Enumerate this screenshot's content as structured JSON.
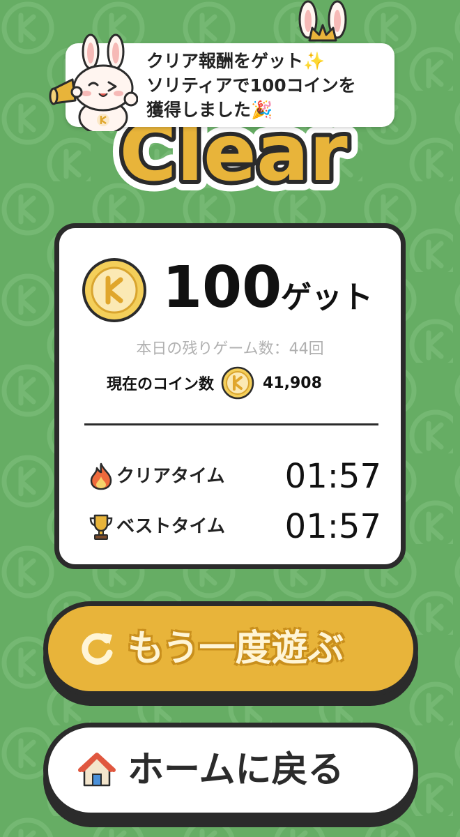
{
  "toast": {
    "line1": "クリア報酬をゲット✨",
    "line2": "ソリティアで100コインを",
    "line3": "獲得しました🎉"
  },
  "title": {
    "text": "Clear"
  },
  "reward": {
    "amount": "100",
    "suffix": "ゲット",
    "remaining_games": "本日の残りゲーム数：44回",
    "current_label": "現在のコイン数",
    "current_value": "41,908"
  },
  "times": {
    "clear_label": "クリアタイム",
    "clear_value": "01:57",
    "best_label": "ベストタイム",
    "best_value": "01:57"
  },
  "buttons": {
    "replay_label": "もう一度遊ぶ",
    "home_label": "ホームに戻る"
  },
  "colors": {
    "background": "#66ad64",
    "accent": "#e8b43a",
    "outline": "#2b2b2b"
  },
  "icons": {
    "coin": "coin-icon",
    "fire": "fire-icon",
    "trophy": "trophy-icon",
    "replay": "replay-icon",
    "home": "home-icon"
  }
}
